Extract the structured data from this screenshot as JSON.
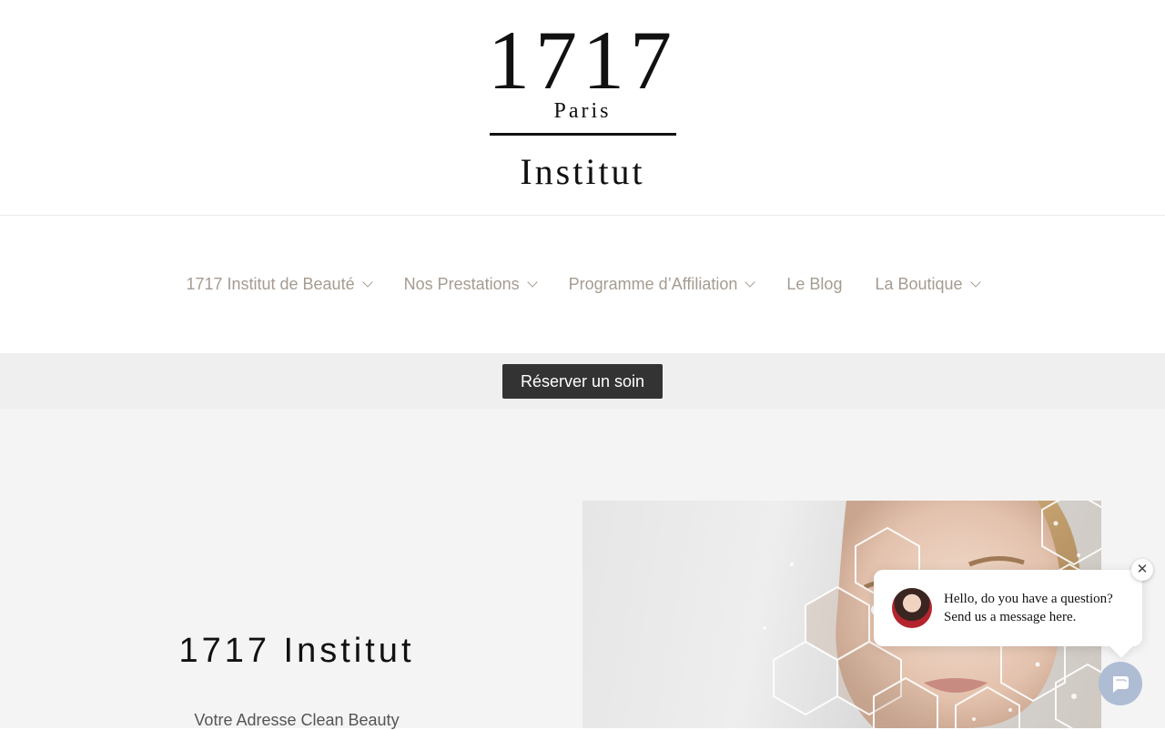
{
  "logo": {
    "number": "1717",
    "city": "Paris",
    "word": "Institut"
  },
  "nav": {
    "items": [
      {
        "label": "1717 Institut de Beauté",
        "has_dropdown": true
      },
      {
        "label": "Nos Prestations",
        "has_dropdown": true
      },
      {
        "label": "Programme d’Affiliation",
        "has_dropdown": true
      },
      {
        "label": "Le Blog",
        "has_dropdown": false
      },
      {
        "label": "La Boutique",
        "has_dropdown": true
      }
    ],
    "text_color": "#a59b91"
  },
  "booking": {
    "button_label": "Réserver un soin",
    "button_color": "#333333"
  },
  "hero": {
    "title": "1717 Institut",
    "subtitle": "Votre Adresse Clean Beauty",
    "background": "#f4f4f4"
  },
  "chat": {
    "message_line1": "Hello, do you have a question?",
    "message_line2": "Send us a message here.",
    "close_icon": "close-icon",
    "launcher_icon": "chat-bubble-icon",
    "launcher_color": "#aebcd4"
  }
}
